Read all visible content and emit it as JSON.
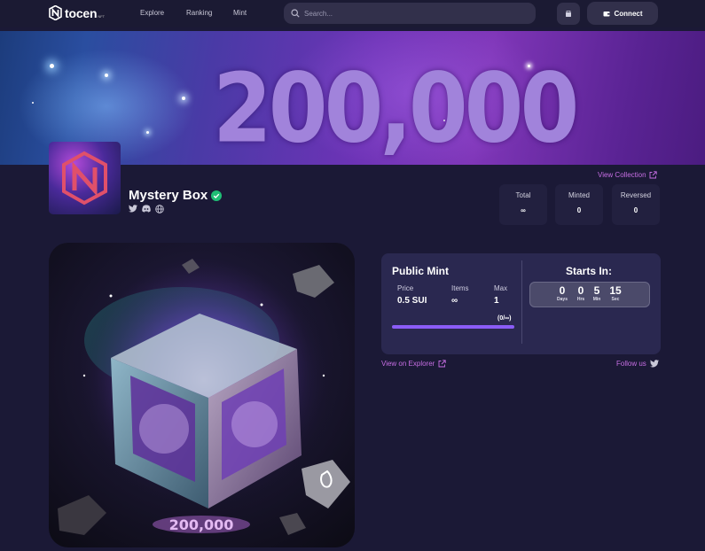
{
  "nav": {
    "logo_text": "tocen",
    "logo_sub": "NFT",
    "links": [
      "Explore",
      "Ranking",
      "Mint"
    ],
    "search_placeholder": "Search...",
    "connect_label": "Connect"
  },
  "banner": {
    "text": "200,000"
  },
  "collection": {
    "name": "Mystery Box",
    "view_collection": "View Collection",
    "stats": [
      {
        "label": "Total",
        "value": "∞"
      },
      {
        "label": "Minted",
        "value": "0"
      },
      {
        "label": "Reversed",
        "value": "0"
      }
    ],
    "artwork_text": "200,000"
  },
  "mint": {
    "title": "Public Mint",
    "price_label": "Price",
    "price_value": "0.5 SUI",
    "items_label": "Items",
    "items_value": "∞",
    "max_label": "Max",
    "max_value": "1",
    "ratio": "(0/∞)",
    "progress_fraction": 1,
    "starts_in": "Starts In:",
    "countdown": [
      {
        "n": "0",
        "u": "Days"
      },
      {
        "n": "0",
        "u": "Hrs"
      },
      {
        "n": "5",
        "u": "Min"
      },
      {
        "n": "15",
        "u": "Sec"
      }
    ]
  },
  "footer": {
    "explorer": "View on Explorer",
    "follow": "Follow us"
  },
  "colors": {
    "background": "#1b1936",
    "accent": "#c76ee4",
    "progress": "#8b5cf6",
    "verified": "#1fbf75"
  }
}
